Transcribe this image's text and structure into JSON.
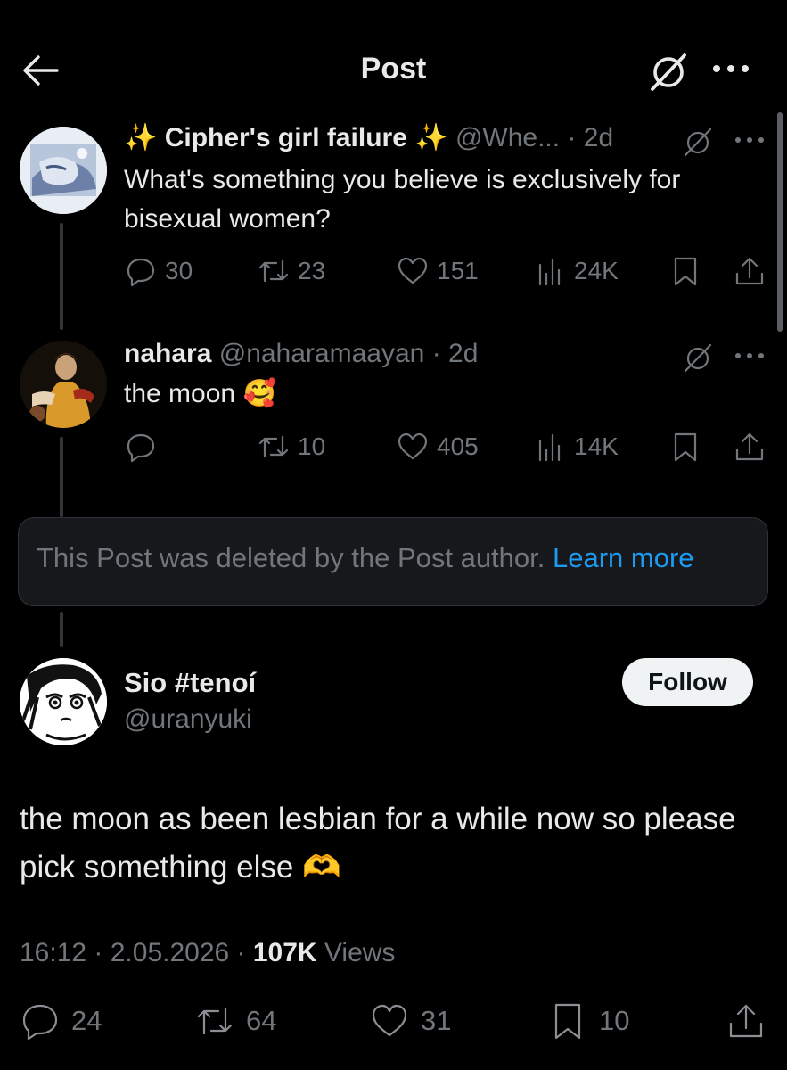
{
  "header": {
    "title": "Post"
  },
  "thread": [
    {
      "name_prefix": "✨",
      "name": "Cipher's girl failure",
      "name_suffix": "✨",
      "handle": "@Whe...",
      "time": "· 2d",
      "text": "What's something you believe is exclusively for bisexual women?",
      "replies": "30",
      "reposts": "23",
      "likes": "151",
      "views": "24K"
    },
    {
      "name": "nahara",
      "handle": "@naharamaayan",
      "time": "· 2d",
      "text": "the moon",
      "emoji": "🥰",
      "replies": "",
      "reposts": "10",
      "likes": "405",
      "views": "14K"
    }
  ],
  "deleted_notice": {
    "text": "This Post was deleted by the Post author.",
    "link": "Learn more"
  },
  "main_post": {
    "name": "Sio #tenoí",
    "handle": "@uranyuki",
    "follow_label": "Follow",
    "text": "the moon as been lesbian for a while now so please pick something else",
    "emoji": "🫶",
    "time": "16:12 · 2.05.2026 ·",
    "views_count": "107K",
    "views_label": "Views",
    "replies": "24",
    "reposts": "64",
    "likes": "31",
    "bookmarks": "10"
  },
  "colors": {
    "accent": "#1d9bf0",
    "background": "#000000",
    "muted": "#71767b",
    "text": "#e7e9ea"
  }
}
